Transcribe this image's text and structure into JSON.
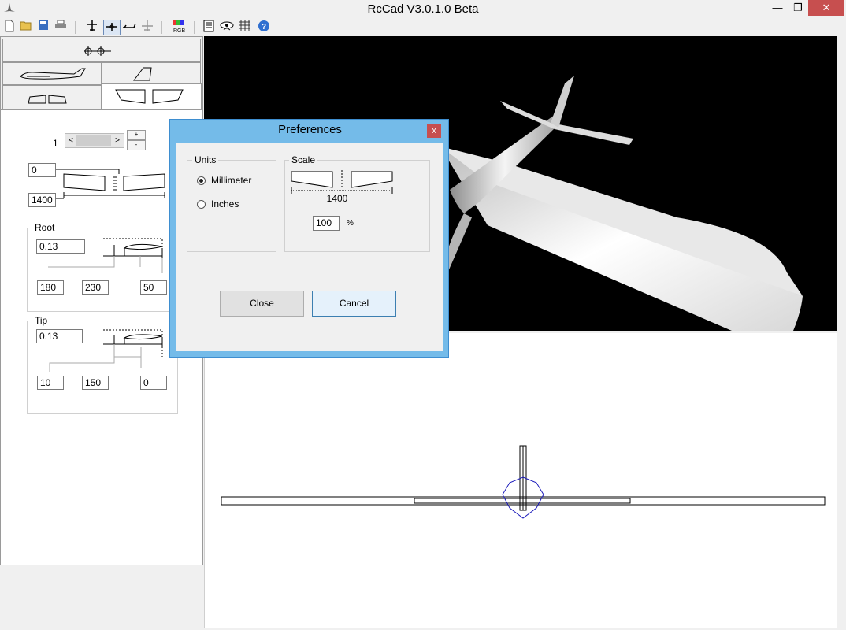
{
  "window": {
    "title": "RcCad V3.0.1.0 Beta",
    "minimize": "—",
    "maximize": "❐",
    "close": "✕"
  },
  "left_panel": {
    "span_section": {
      "selector_value": "1",
      "offset_value": "0",
      "span_value": "1400"
    },
    "root": {
      "label": "Root",
      "ratio_value": "0.13",
      "chord_a": "180",
      "chord_b": "230",
      "chord_c": "50"
    },
    "tip": {
      "label": "Tip",
      "ratio_value": "0.13",
      "chord_a": "10",
      "chord_b": "150",
      "chord_c": "0"
    }
  },
  "dialog": {
    "title": "Preferences",
    "close_glyph": "x",
    "units": {
      "label": "Units",
      "options": [
        "Millimeter",
        "Inches"
      ],
      "selected": "Millimeter"
    },
    "scale": {
      "label": "Scale",
      "dimension": "1400",
      "value": "100",
      "unit": "%"
    },
    "close_button": "Close",
    "cancel_button": "Cancel"
  },
  "colors": {
    "dialog_frame": "#74bbe9",
    "title_close": "#c74f4f",
    "view_bg": "#000000",
    "fuselage_circle": "#1b1bbb"
  }
}
